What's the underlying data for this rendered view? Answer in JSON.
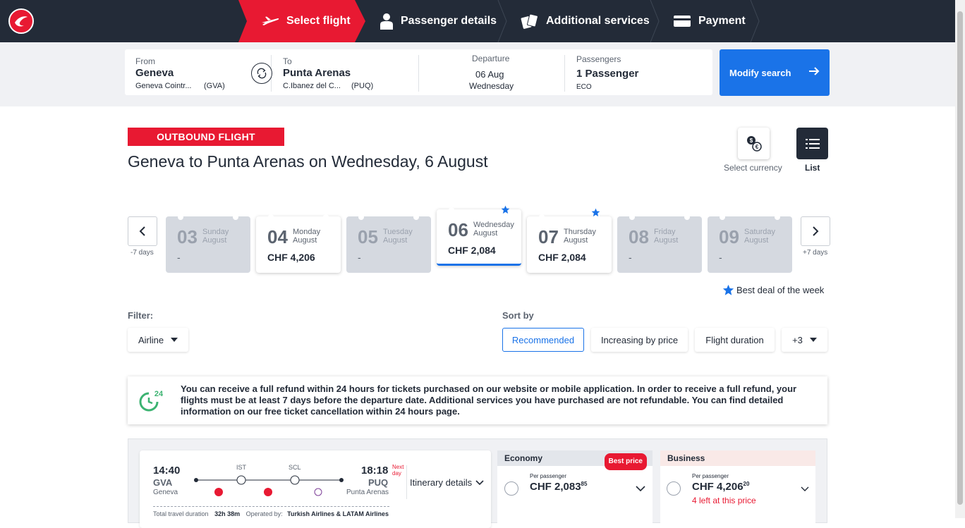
{
  "nav": {
    "steps": [
      {
        "label": "Select flight",
        "icon": "plane-icon",
        "active": true
      },
      {
        "label": "Passenger details",
        "icon": "person-icon",
        "active": false
      },
      {
        "label": "Additional services",
        "icon": "cards-icon",
        "active": false
      },
      {
        "label": "Payment",
        "icon": "card-icon",
        "active": false
      }
    ],
    "brand_color": "#e81932",
    "bar_color": "#232b38"
  },
  "search": {
    "from_label": "From",
    "from_city": "Geneva",
    "from_airport": "Geneva Cointr...",
    "from_code": "(GVA)",
    "to_label": "To",
    "to_city": "Punta Arenas",
    "to_airport": "C.Ibanez del C...",
    "to_code": "(PUQ)",
    "departure_label": "Departure",
    "departure_date": "06 Aug",
    "departure_day": "Wednesday",
    "passengers_label": "Passengers",
    "passengers_value": "1 Passenger",
    "cabin": "ECO",
    "modify_label": "Modify search",
    "accent_color": "#1a73e8"
  },
  "heading": {
    "badge": "OUTBOUND FLIGHT",
    "title": "Geneva to Punta Arenas on Wednesday, 6 August",
    "currency_label": "Select currency",
    "list_label": "List"
  },
  "dates": {
    "prev_label": "-7 days",
    "next_label": "+7 days",
    "days": [
      {
        "num": "03",
        "name": "Sunday",
        "month": "August",
        "price": "-",
        "state": "disabled",
        "best": false
      },
      {
        "num": "04",
        "name": "Monday",
        "month": "August",
        "price": "CHF 4,206",
        "state": "enabled",
        "best": false
      },
      {
        "num": "05",
        "name": "Tuesday",
        "month": "August",
        "price": "-",
        "state": "disabled",
        "best": false
      },
      {
        "num": "06",
        "name": "Wednesday",
        "month": "August",
        "price": "CHF 2,084",
        "state": "selected",
        "best": true
      },
      {
        "num": "07",
        "name": "Thursday",
        "month": "August",
        "price": "CHF 2,084",
        "state": "enabled",
        "best": true
      },
      {
        "num": "08",
        "name": "Friday",
        "month": "August",
        "price": "-",
        "state": "disabled",
        "best": false
      },
      {
        "num": "09",
        "name": "Saturday",
        "month": "August",
        "price": "-",
        "state": "disabled",
        "best": false
      }
    ],
    "best_deal_label": "Best deal of the week"
  },
  "filters": {
    "filter_label": "Filter:",
    "airline_label": "Airline",
    "sort_label": "Sort by",
    "sort_options": [
      "Recommended",
      "Increasing by price",
      "Flight duration",
      "+3"
    ],
    "sort_selected": "Recommended"
  },
  "refund": {
    "badge": "24",
    "text": "You can receive a full refund within 24 hours for tickets purchased on our website or mobile application. In order to receive a full refund, your flights must be at least 7 days before the departure date. Additional services you have purchased are not refundable. You can find detailed information on our free ticket cancellation within 24 hours page."
  },
  "flight": {
    "dep_time": "14:40",
    "dep_code": "GVA",
    "dep_city": "Geneva",
    "arr_time": "18:18",
    "arr_code": "PUQ",
    "arr_city": "Punta Arenas",
    "next_day_1": "Next",
    "next_day_2": "day",
    "stops": [
      "IST",
      "SCL"
    ],
    "itinerary_label": "Itinerary details",
    "duration_label": "Total travel duration",
    "duration_value": "32h 38m",
    "operated_label": "Operated by:",
    "operated_value": "Turkish Airlines & LATAM Airlines"
  },
  "fares": {
    "economy": {
      "label": "Economy",
      "badge": "Best price",
      "per_pax": "Per passenger",
      "price": "CHF 2,083",
      "cents": "85"
    },
    "business": {
      "label": "Business",
      "per_pax": "Per passenger",
      "price": "CHF 4,206",
      "cents": "20",
      "seats_left": "4 left at this price"
    }
  }
}
